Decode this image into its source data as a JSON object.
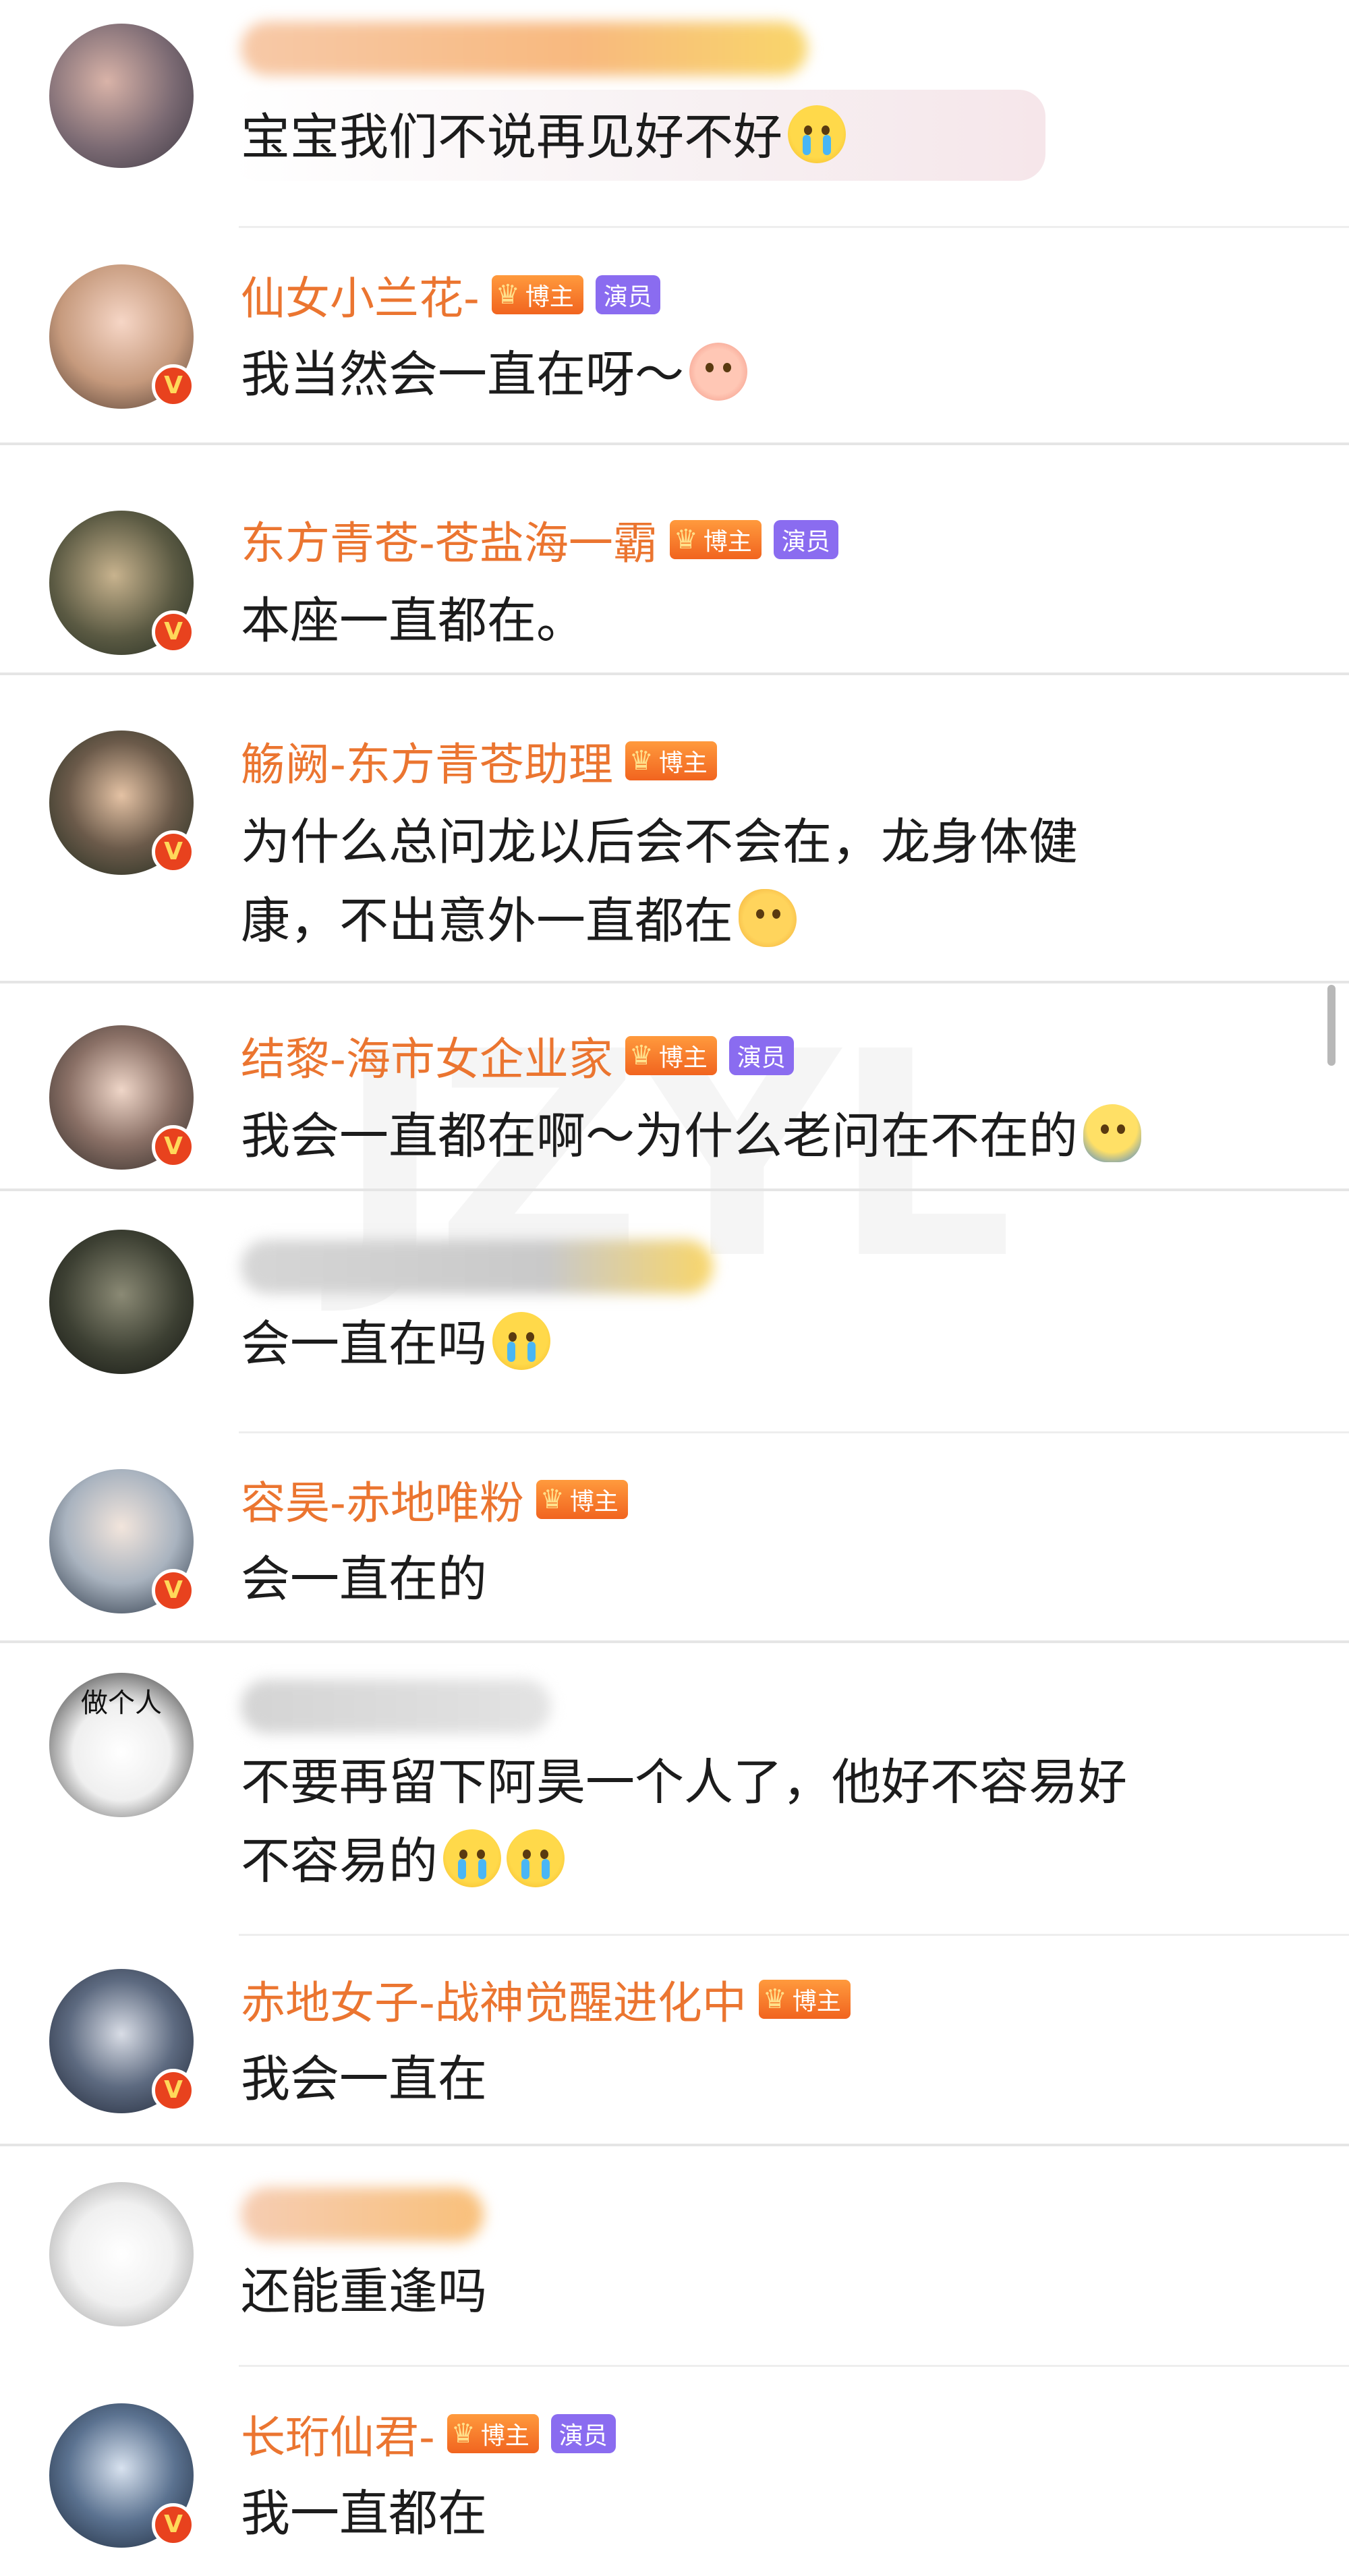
{
  "colors": {
    "name_accent": "#eb7530",
    "text": "#1c1c1c",
    "badge_bozhu": "#f1641f",
    "badge_yanyuan": "#8a6cf0",
    "verified_badge": "#e8421e"
  },
  "badges": {
    "bozhu": "博主",
    "yanyuan": "演员",
    "verified": "V"
  },
  "watermark": "JZYL",
  "comments": [
    {
      "name": "",
      "text": "宝宝我们不说再见好不好",
      "emoji": "crying-face"
    },
    {
      "name": "仙女小兰花-",
      "text": "我当然会一直在呀～",
      "emoji": "pink-blob-face"
    },
    {
      "name": "东方青苍-苍盐海一霸",
      "text": "本座一直都在。"
    },
    {
      "name": "觞阙-东方青苍助理",
      "text_line1": "为什么总问龙以后会不会在，龙身体健",
      "text_line2": "康，不出意外一直都在",
      "emoji": "melting-face"
    },
    {
      "name": "结黎-海市女企业家",
      "text": "我会一直都在啊～为什么老问在不在的",
      "emoji": "duck-face"
    },
    {
      "name": "",
      "text": "会一直在吗",
      "emoji": "crying-face"
    },
    {
      "name": "容昊-赤地唯粉",
      "text": "会一直在的"
    },
    {
      "name": "",
      "avatar_caption": "做个人",
      "text_line1": "不要再留下阿昊一个人了，他好不容易好",
      "text_line2": "不容易的",
      "emoji": "crying-face"
    },
    {
      "name": "赤地女子-战神觉醒进化中",
      "text": "我会一直在"
    },
    {
      "name": "",
      "text": "还能重逢吗"
    },
    {
      "name": "长珩仙君-",
      "text": "我一直都在"
    }
  ]
}
